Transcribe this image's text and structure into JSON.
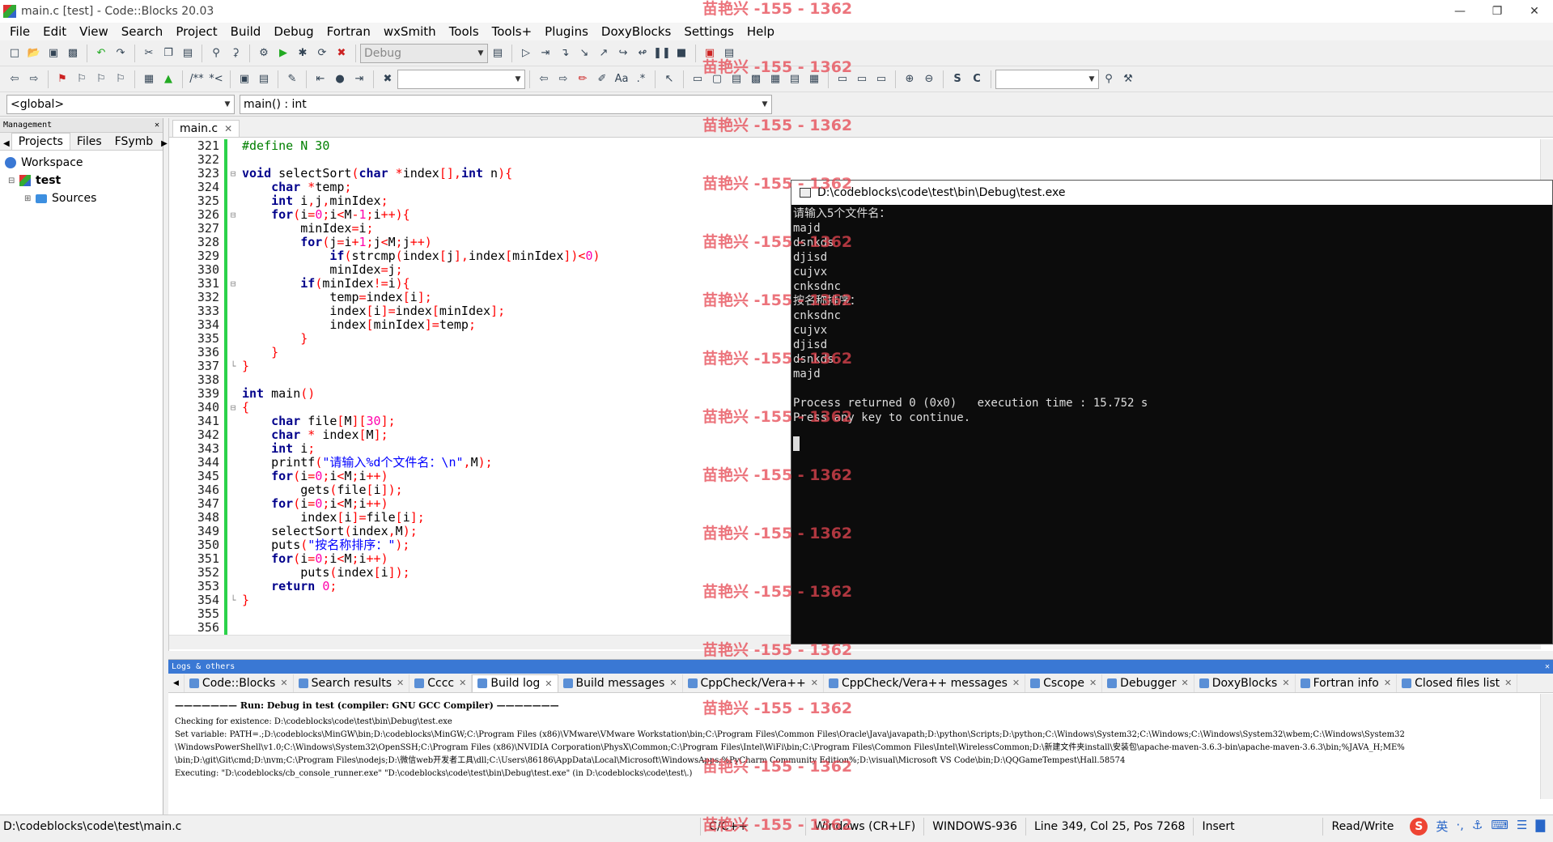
{
  "window": {
    "title": "main.c [test] - Code::Blocks 20.03",
    "controls": [
      "—",
      "❐",
      "✕"
    ]
  },
  "menu": [
    "File",
    "Edit",
    "View",
    "Search",
    "Project",
    "Build",
    "Debug",
    "Fortran",
    "wxSmith",
    "Tools",
    "Tools+",
    "Plugins",
    "DoxyBlocks",
    "Settings",
    "Help"
  ],
  "toolbar": {
    "build_target": "Debug",
    "search_combo": "",
    "find_combo": ""
  },
  "scope": {
    "global": "<global>",
    "function": "main() : int"
  },
  "management": {
    "title": "Management",
    "tabs": [
      "Projects",
      "Files",
      "FSymb"
    ],
    "tree": {
      "workspace": "Workspace",
      "project": "test",
      "folder": "Sources"
    }
  },
  "editor": {
    "tab": "main.c",
    "lines": [
      {
        "n": "321",
        "html": "<span class=\"pp\">#define N 30</span>"
      },
      {
        "n": "322",
        "html": ""
      },
      {
        "n": "323",
        "html": "<span class=\"kw\">void</span> selectSort<span class=\"op\">(</span><span class=\"kw\">char</span> <span class=\"op\">*</span>index<span class=\"op\">[],</span><span class=\"kw\">int</span> n<span class=\"op\">){</span>"
      },
      {
        "n": "324",
        "html": "    <span class=\"kw\">char</span> <span class=\"op\">*</span>temp<span class=\"op\">;</span>"
      },
      {
        "n": "325",
        "html": "    <span class=\"kw\">int</span> i<span class=\"op\">,</span>j<span class=\"op\">,</span>minIdex<span class=\"op\">;</span>"
      },
      {
        "n": "326",
        "html": "    <span class=\"kw\">for</span><span class=\"op\">(</span>i<span class=\"op\">=</span><span class=\"num\">0</span><span class=\"op\">;</span>i<span class=\"op\">&lt;</span>M<span class=\"op\">-</span><span class=\"num\">1</span><span class=\"op\">;</span>i<span class=\"op\">++){</span>"
      },
      {
        "n": "327",
        "html": "        minIdex<span class=\"op\">=</span>i<span class=\"op\">;</span>"
      },
      {
        "n": "328",
        "html": "        <span class=\"kw\">for</span><span class=\"op\">(</span>j<span class=\"op\">=</span>i<span class=\"op\">+</span><span class=\"num\">1</span><span class=\"op\">;</span>j<span class=\"op\">&lt;</span>M<span class=\"op\">;</span>j<span class=\"op\">++)</span>"
      },
      {
        "n": "329",
        "html": "            <span class=\"kw\">if</span><span class=\"op\">(</span>strcmp<span class=\"op\">(</span>index<span class=\"op\">[</span>j<span class=\"op\">],</span>index<span class=\"op\">[</span>minIdex<span class=\"op\">])&lt;</span><span class=\"num\">0</span><span class=\"op\">)</span>"
      },
      {
        "n": "330",
        "html": "            minIdex<span class=\"op\">=</span>j<span class=\"op\">;</span>"
      },
      {
        "n": "331",
        "html": "        <span class=\"kw\">if</span><span class=\"op\">(</span>minIdex<span class=\"op\">!=</span>i<span class=\"op\">){</span>"
      },
      {
        "n": "332",
        "html": "            temp<span class=\"op\">=</span>index<span class=\"op\">[</span>i<span class=\"op\">];</span>"
      },
      {
        "n": "333",
        "html": "            index<span class=\"op\">[</span>i<span class=\"op\">]=</span>index<span class=\"op\">[</span>minIdex<span class=\"op\">];</span>"
      },
      {
        "n": "334",
        "html": "            index<span class=\"op\">[</span>minIdex<span class=\"op\">]=</span>temp<span class=\"op\">;</span>"
      },
      {
        "n": "335",
        "html": "        <span class=\"op\">}</span>"
      },
      {
        "n": "336",
        "html": "    <span class=\"op\">}</span>"
      },
      {
        "n": "337",
        "html": "<span class=\"op\">}</span>"
      },
      {
        "n": "338",
        "html": ""
      },
      {
        "n": "339",
        "html": "<span class=\"kw\">int</span> main<span class=\"op\">()</span>"
      },
      {
        "n": "340",
        "html": "<span class=\"op\">{</span>"
      },
      {
        "n": "341",
        "html": "    <span class=\"kw\">char</span> file<span class=\"op\">[</span>M<span class=\"op\">][</span><span class=\"num\">30</span><span class=\"op\">];</span>"
      },
      {
        "n": "342",
        "html": "    <span class=\"kw\">char</span> <span class=\"op\">*</span> index<span class=\"op\">[</span>M<span class=\"op\">];</span>"
      },
      {
        "n": "343",
        "html": "    <span class=\"kw\">int</span> i<span class=\"op\">;</span>"
      },
      {
        "n": "344",
        "html": "    printf<span class=\"op\">(</span><span class=\"str\">\"请输入%d个文件名：\\n\"</span><span class=\"op\">,</span>M<span class=\"op\">);</span>"
      },
      {
        "n": "345",
        "html": "    <span class=\"kw\">for</span><span class=\"op\">(</span>i<span class=\"op\">=</span><span class=\"num\">0</span><span class=\"op\">;</span>i<span class=\"op\">&lt;</span>M<span class=\"op\">;</span>i<span class=\"op\">++)</span>"
      },
      {
        "n": "346",
        "html": "        gets<span class=\"op\">(</span>file<span class=\"op\">[</span>i<span class=\"op\">]);</span>"
      },
      {
        "n": "347",
        "html": "    <span class=\"kw\">for</span><span class=\"op\">(</span>i<span class=\"op\">=</span><span class=\"num\">0</span><span class=\"op\">;</span>i<span class=\"op\">&lt;</span>M<span class=\"op\">;</span>i<span class=\"op\">++)</span>"
      },
      {
        "n": "348",
        "html": "        index<span class=\"op\">[</span>i<span class=\"op\">]=</span>file<span class=\"op\">[</span>i<span class=\"op\">];</span>"
      },
      {
        "n": "349",
        "html": "    selectSort<span class=\"op\">(</span>index<span class=\"op\">,</span>M<span class=\"op\">);</span>"
      },
      {
        "n": "350",
        "html": "    puts<span class=\"op\">(</span><span class=\"str\">\"按名称排序：\"</span><span class=\"op\">);</span>"
      },
      {
        "n": "351",
        "html": "    <span class=\"kw\">for</span><span class=\"op\">(</span>i<span class=\"op\">=</span><span class=\"num\">0</span><span class=\"op\">;</span>i<span class=\"op\">&lt;</span>M<span class=\"op\">;</span>i<span class=\"op\">++)</span>"
      },
      {
        "n": "352",
        "html": "        puts<span class=\"op\">(</span>index<span class=\"op\">[</span>i<span class=\"op\">]);</span>"
      },
      {
        "n": "353",
        "html": "    <span class=\"kw\">return</span> <span class=\"num\">0</span><span class=\"op\">;</span>"
      },
      {
        "n": "354",
        "html": "<span class=\"op\">}</span>"
      },
      {
        "n": "355",
        "html": ""
      },
      {
        "n": "356",
        "html": ""
      }
    ],
    "folds": {
      "323": "⊟",
      "326": "⊟",
      "331": "⊟",
      "337": "└",
      "340": "⊟",
      "354": "└"
    }
  },
  "console": {
    "title": "D:\\codeblocks\\code\\test\\bin\\Debug\\test.exe",
    "lines": [
      "请输入5个文件名：",
      "majd",
      "dsnkds",
      "djisd",
      "cujvx",
      "cnksdnc",
      "按名称排序：",
      "cnksdnc",
      "cujvx",
      "djisd",
      "dsnkds",
      "majd",
      "",
      "Process returned 0 (0x0)   execution time : 15.752 s",
      "Press any key to continue."
    ]
  },
  "logs": {
    "title": "Logs & others",
    "tabs": [
      "Code::Blocks",
      "Search results",
      "Cccc",
      "Build log",
      "Build messages",
      "CppCheck/Vera++",
      "CppCheck/Vera++ messages",
      "Cscope",
      "Debugger",
      "DoxyBlocks",
      "Fortran info",
      "Closed files list"
    ],
    "active_tab": "Build log",
    "run_line": "Run: Debug in test (compiler: GNU GCC Compiler)",
    "lines": [
      "Checking for existence: D:\\codeblocks\\code\\test\\bin\\Debug\\test.exe",
      "Set variable: PATH=.;D:\\codeblocks\\MinGW\\bin;D:\\codeblocks\\MinGW;C:\\Program Files (x86)\\VMware\\VMware Workstation\\bin;C:\\Program Files\\Common Files\\Oracle\\Java\\javapath;D:\\python\\Scripts;D:\\python;C:\\Windows\\System32;C:\\Windows;C:\\Windows\\System32\\wbem;C:\\Windows\\System32",
      "\\WindowsPowerShell\\v1.0;C:\\Windows\\System32\\OpenSSH;C:\\Program Files (x86)\\NVIDIA Corporation\\PhysX\\Common;C:\\Program Files\\Intel\\WiFi\\bin;C:\\Program Files\\Common Files\\Intel\\WirelessCommon;D:\\新建文件夹install\\安装包\\apache-maven-3.6.3-bin\\apache-maven-3.6.3\\bin;%JAVA_H;ME%",
      "\\bin;D:\\git\\Git\\cmd;D:\\nvm;C:\\Program Files\\nodejs;D:\\微信web开发者工具\\dll;C:\\Users\\86186\\AppData\\Local\\Microsoft\\WindowsApps;%PyCharm Community Edition%;D:\\visual\\Microsoft VS Code\\bin;D:\\QQGameTempest\\Hall.58574",
      "Executing: \"D:\\codeblocks/cb_console_runner.exe\" \"D:\\codeblocks\\code\\test\\bin\\Debug\\test.exe\"  (in D:\\codeblocks\\code\\test\\.)"
    ]
  },
  "status": {
    "path": "D:\\codeblocks\\code\\test\\main.c",
    "lang": "C/C++",
    "eol": "Windows (CR+LF)",
    "encoding": "WINDOWS-936",
    "position": "Line 349, Col 25, Pos 7268",
    "mode": "Insert",
    "access": "Read/Write",
    "ime": [
      "英",
      "·,",
      "⚓",
      "⌨",
      "☰",
      "▇"
    ]
  },
  "watermark": "苗艳兴 -155 - 1362",
  "colors": {
    "changebar": "#2bd24a",
    "keyword": "#00008b",
    "preprocessor": "#008000",
    "number": "#ff00aa",
    "string": "#0000ff",
    "operator": "#ff0000"
  }
}
